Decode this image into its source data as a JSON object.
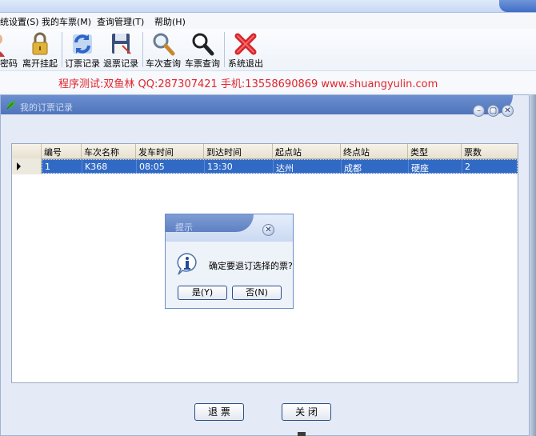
{
  "menubar": {
    "items": [
      "统设置(S)",
      "我的车票(M)",
      "查询管理(T)",
      "帮助(H)"
    ]
  },
  "toolbar": {
    "items": [
      {
        "label": "密码",
        "icon": "password-user-icon"
      },
      {
        "label": "离开挂起",
        "icon": "padlock-icon"
      },
      {
        "label": "订票记录",
        "icon": "refresh-arrows-icon"
      },
      {
        "label": "退票记录",
        "icon": "floppy-save-icon"
      },
      {
        "label": "车次查询",
        "icon": "magnifier-icon"
      },
      {
        "label": "车票查询",
        "icon": "magnifier-dark-icon"
      },
      {
        "label": "系统退出",
        "icon": "red-x-exit-icon"
      }
    ]
  },
  "banner": {
    "text": "程序测试:双鱼林 QQ:287307421 手机:13558690869 www.shuangyulin.com",
    "color": "#e0262b"
  },
  "child_window": {
    "title": "我的订票记录",
    "controls": {
      "minimize": "–",
      "restore": "▢",
      "close": "✕"
    }
  },
  "grid": {
    "columns": [
      "编号",
      "车次名称",
      "发车时间",
      "到达时间",
      "起点站",
      "终点站",
      "类型",
      "票数"
    ],
    "rows": [
      [
        "1",
        "K368",
        "08:05",
        "13:30",
        "达州",
        "成都",
        "硬座",
        "2"
      ]
    ],
    "selected_row_color": "#316ac5"
  },
  "buttons": {
    "refund": "退  票",
    "close": "关  闭"
  },
  "msgbox": {
    "title": "提示",
    "text": "确定要退订选择的票?",
    "yes": "是(Y)",
    "no": "否(N)",
    "close": "✕"
  }
}
